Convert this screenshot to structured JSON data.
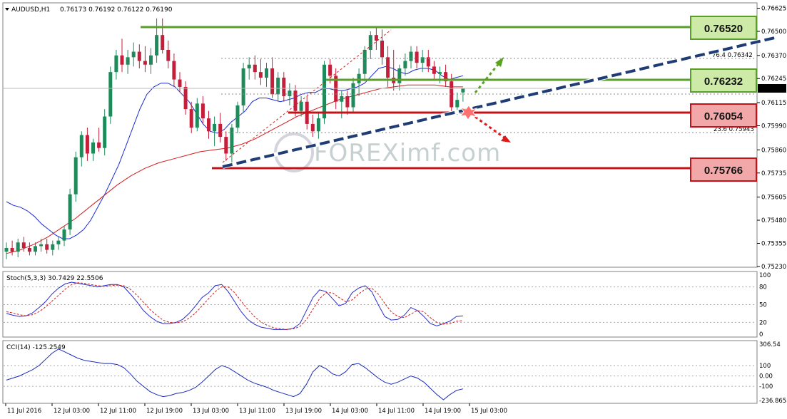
{
  "header": {
    "symbol_tf": "AUDUSD,H1",
    "ohlc": "0.76173 0.76192 0.76122 0.76190"
  },
  "watermark": "FOREXimf.com",
  "colors": {
    "bull_candle": "#1f8a5a",
    "bear_candle": "#c41e3a",
    "ma_fast": "#1c2bd6",
    "ma_slow": "#d31c1c",
    "support_line": "#c0141a",
    "resistance_line": "#5a9e2a",
    "trendline": "#1f3d74",
    "green_box": "#cdeaa6",
    "red_box": "#f2a8a8",
    "stoch_main": "#2a2acf",
    "stoch_signal": "#d31c1c",
    "cci": "#1a2ab8"
  },
  "main_panel": {
    "price_axis": [
      "0.76625",
      "0.76500",
      "0.76370",
      "0.76245",
      "0.76115",
      "0.75990",
      "0.75860",
      "0.75735",
      "0.75605",
      "0.75480",
      "0.75355",
      "0.75230"
    ],
    "current_price": "0.76190",
    "levels": [
      {
        "label": "0.76520",
        "kind": "resistance",
        "price": 0.7652
      },
      {
        "label": "0.76232",
        "kind": "resistance",
        "price": 0.76232
      },
      {
        "label": "0.76054",
        "kind": "support",
        "price": 0.76054
      },
      {
        "label": "0.75766",
        "kind": "support",
        "price": 0.75766
      }
    ],
    "fib_labels": [
      "76.4  0.76342",
      "38.0  0.76166",
      "23.6  0.75943"
    ]
  },
  "stoch_panel": {
    "label": "Stoch(5,3,3) 30.7429 22.5506",
    "axis": [
      "100",
      "80",
      "50",
      "20",
      "0"
    ]
  },
  "cci_panel": {
    "label": "CCI(14) -125.2549",
    "axis": [
      "306.54",
      "100",
      "0.00",
      "-100",
      "-236.8658"
    ]
  },
  "time_axis": [
    "11 Jul 2016",
    "12 Jul 03:00",
    "12 Jul 11:00",
    "12 Jul 19:00",
    "13 Jul 03:00",
    "13 Jul 11:00",
    "13 Jul 19:00",
    "14 Jul 03:00",
    "14 Jul 11:00",
    "14 Jul 19:00",
    "15 Jul 03:00"
  ],
  "chart_data": {
    "type": "candlestick",
    "title": "AUDUSD,H1",
    "ylim": [
      0.7523,
      0.7665
    ],
    "candles": [
      [
        0.7531,
        0.7536,
        0.7527,
        0.7533
      ],
      [
        0.7533,
        0.7537,
        0.7529,
        0.7531
      ],
      [
        0.7531,
        0.7538,
        0.7528,
        0.7536
      ],
      [
        0.7536,
        0.7539,
        0.7531,
        0.7533
      ],
      [
        0.7533,
        0.7536,
        0.7529,
        0.7531
      ],
      [
        0.7531,
        0.7536,
        0.7529,
        0.7534
      ],
      [
        0.7534,
        0.7538,
        0.7531,
        0.7535
      ],
      [
        0.7535,
        0.7538,
        0.753,
        0.7532
      ],
      [
        0.7532,
        0.7537,
        0.7529,
        0.7535
      ],
      [
        0.7535,
        0.7539,
        0.7532,
        0.7537
      ],
      [
        0.7537,
        0.7545,
        0.7534,
        0.7543
      ],
      [
        0.7543,
        0.7565,
        0.754,
        0.7562
      ],
      [
        0.7562,
        0.7585,
        0.7558,
        0.7582
      ],
      [
        0.7582,
        0.7596,
        0.7577,
        0.7594
      ],
      [
        0.7594,
        0.7598,
        0.758,
        0.7584
      ],
      [
        0.7584,
        0.7592,
        0.758,
        0.759
      ],
      [
        0.759,
        0.7598,
        0.7585,
        0.7587
      ],
      [
        0.7587,
        0.7608,
        0.7583,
        0.7604
      ],
      [
        0.7604,
        0.7631,
        0.76,
        0.7628
      ],
      [
        0.7628,
        0.764,
        0.7624,
        0.7637
      ],
      [
        0.7637,
        0.7646,
        0.7628,
        0.7632
      ],
      [
        0.7632,
        0.764,
        0.7627,
        0.7636
      ],
      [
        0.7636,
        0.7644,
        0.7631,
        0.7639
      ],
      [
        0.7639,
        0.7643,
        0.763,
        0.7634
      ],
      [
        0.7634,
        0.7642,
        0.7628,
        0.7632
      ],
      [
        0.7632,
        0.7641,
        0.7627,
        0.7637
      ],
      [
        0.7637,
        0.7657,
        0.7633,
        0.7648
      ],
      [
        0.7648,
        0.7657,
        0.7638,
        0.764
      ],
      [
        0.764,
        0.7645,
        0.763,
        0.7634
      ],
      [
        0.7634,
        0.7638,
        0.762,
        0.7624
      ],
      [
        0.7624,
        0.7628,
        0.7617,
        0.762
      ],
      [
        0.762,
        0.7623,
        0.7605,
        0.7608
      ],
      [
        0.7608,
        0.7612,
        0.7595,
        0.7598
      ],
      [
        0.7598,
        0.7614,
        0.7596,
        0.7611
      ],
      [
        0.7611,
        0.7615,
        0.76,
        0.7603
      ],
      [
        0.7603,
        0.7607,
        0.7592,
        0.7596
      ],
      [
        0.7596,
        0.7604,
        0.7588,
        0.76
      ],
      [
        0.76,
        0.7606,
        0.759,
        0.7593
      ],
      [
        0.7593,
        0.7596,
        0.758,
        0.7584
      ],
      [
        0.7584,
        0.76,
        0.7579,
        0.7598
      ],
      [
        0.7598,
        0.7612,
        0.7595,
        0.761
      ],
      [
        0.761,
        0.7633,
        0.7606,
        0.763
      ],
      [
        0.763,
        0.7636,
        0.7624,
        0.7632
      ],
      [
        0.7632,
        0.7637,
        0.7624,
        0.7628
      ],
      [
        0.7628,
        0.7635,
        0.7621,
        0.7625
      ],
      [
        0.7625,
        0.7633,
        0.762,
        0.763
      ],
      [
        0.763,
        0.7636,
        0.7614,
        0.7616
      ],
      [
        0.7616,
        0.7628,
        0.7612,
        0.7625
      ],
      [
        0.7625,
        0.7628,
        0.7612,
        0.7615
      ],
      [
        0.7615,
        0.7622,
        0.761,
        0.7618
      ],
      [
        0.7618,
        0.7621,
        0.7604,
        0.7607
      ],
      [
        0.7607,
        0.7615,
        0.7604,
        0.7612
      ],
      [
        0.7612,
        0.7615,
        0.7597,
        0.76
      ],
      [
        0.76,
        0.7605,
        0.7593,
        0.7596
      ],
      [
        0.7596,
        0.7606,
        0.7592,
        0.7603
      ],
      [
        0.7603,
        0.7634,
        0.76,
        0.7632
      ],
      [
        0.7632,
        0.7635,
        0.7622,
        0.7626
      ],
      [
        0.7626,
        0.763,
        0.7608,
        0.7612
      ],
      [
        0.7612,
        0.7618,
        0.7603,
        0.7615
      ],
      [
        0.7615,
        0.7618,
        0.7605,
        0.7609
      ],
      [
        0.7609,
        0.7625,
        0.7606,
        0.7622
      ],
      [
        0.7622,
        0.763,
        0.7615,
        0.7627
      ],
      [
        0.7627,
        0.7642,
        0.7623,
        0.764
      ],
      [
        0.764,
        0.765,
        0.7635,
        0.7648
      ],
      [
        0.7648,
        0.7652,
        0.764,
        0.7645
      ],
      [
        0.7645,
        0.7651,
        0.7632,
        0.7636
      ],
      [
        0.7636,
        0.7642,
        0.762,
        0.7625
      ],
      [
        0.7625,
        0.764,
        0.7618,
        0.7622
      ],
      [
        0.7622,
        0.7632,
        0.7618,
        0.763
      ],
      [
        0.763,
        0.7638,
        0.7626,
        0.7634
      ],
      [
        0.7634,
        0.7642,
        0.763,
        0.7639
      ],
      [
        0.7639,
        0.7642,
        0.763,
        0.7633
      ],
      [
        0.7633,
        0.764,
        0.7628,
        0.7636
      ],
      [
        0.7636,
        0.764,
        0.7628,
        0.7631
      ],
      [
        0.7631,
        0.7634,
        0.7624,
        0.7627
      ],
      [
        0.7627,
        0.7631,
        0.7622,
        0.7628
      ],
      [
        0.7628,
        0.7632,
        0.762,
        0.7623
      ],
      [
        0.7623,
        0.7627,
        0.7606,
        0.7609
      ],
      [
        0.7609,
        0.7617,
        0.7605,
        0.7613
      ],
      [
        0.7617,
        0.7619,
        0.7612,
        0.7619
      ]
    ],
    "ma_fast_points": [
      0.7558,
      0.7556,
      0.7555,
      0.7553,
      0.755,
      0.7546,
      0.7543,
      0.754,
      0.7538,
      0.7538,
      0.754,
      0.7543,
      0.7548,
      0.7555,
      0.7562,
      0.757,
      0.7578,
      0.7588,
      0.7598,
      0.7608,
      0.7616,
      0.762,
      0.7622,
      0.7622,
      0.762,
      0.7616,
      0.7612,
      0.7606,
      0.76,
      0.7596,
      0.7595,
      0.7597,
      0.7601,
      0.7604,
      0.7607,
      0.7612,
      0.7614,
      0.7614,
      0.7613,
      0.7612,
      0.7613,
      0.7614,
      0.7616,
      0.7617,
      0.7617,
      0.7619,
      0.7619,
      0.7618,
      0.7618,
      0.7619,
      0.762,
      0.7622,
      0.7626,
      0.763,
      0.7631,
      0.763,
      0.7628,
      0.7627,
      0.7629,
      0.763,
      0.763,
      0.7629,
      0.7626,
      0.7624,
      0.7625,
      0.7626
    ],
    "ma_slow_points": [
      0.753,
      0.7532,
      0.7535,
      0.7539,
      0.7544,
      0.7549,
      0.7555,
      0.7561,
      0.7567,
      0.7572,
      0.7576,
      0.7579,
      0.7581,
      0.7583,
      0.7585,
      0.7586,
      0.7587,
      0.7589,
      0.7592,
      0.7596,
      0.76,
      0.7604,
      0.7607,
      0.761,
      0.7613,
      0.7615,
      0.7617,
      0.7619,
      0.762,
      0.7621,
      0.7621,
      0.7621,
      0.762,
      0.762
    ],
    "stoch_main": [
      35,
      32,
      30,
      31,
      36,
      45,
      55,
      68,
      78,
      85,
      88,
      86,
      84,
      82,
      80,
      82,
      84,
      84,
      80,
      68,
      55,
      40,
      30,
      22,
      18,
      18,
      20,
      25,
      35,
      48,
      62,
      70,
      82,
      84,
      72,
      55,
      38,
      25,
      17,
      12,
      10,
      8,
      8,
      8,
      10,
      18,
      40,
      62,
      75,
      72,
      60,
      48,
      52,
      70,
      78,
      82,
      72,
      50,
      30,
      24,
      25,
      32,
      45,
      40,
      30,
      18,
      14,
      18,
      22,
      30,
      31
    ],
    "stoch_signal": [
      38,
      36,
      33,
      31,
      33,
      38,
      46,
      56,
      66,
      76,
      84,
      87,
      86,
      84,
      82,
      81,
      82,
      83,
      82,
      76,
      66,
      54,
      42,
      32,
      24,
      20,
      19,
      21,
      27,
      36,
      48,
      60,
      72,
      80,
      80,
      70,
      56,
      42,
      30,
      21,
      15,
      11,
      9,
      8,
      9,
      13,
      25,
      42,
      60,
      70,
      70,
      62,
      55,
      58,
      68,
      76,
      78,
      68,
      52,
      38,
      30,
      28,
      34,
      40,
      38,
      28,
      20,
      17,
      18,
      22,
      23
    ],
    "cci": [
      -40,
      -20,
      0,
      30,
      60,
      100,
      160,
      220,
      260,
      230,
      200,
      170,
      150,
      140,
      130,
      120,
      120,
      110,
      80,
      20,
      -50,
      -100,
      -150,
      -180,
      -200,
      -190,
      -170,
      -160,
      -140,
      -110,
      -60,
      0,
      60,
      100,
      80,
      40,
      0,
      -40,
      -70,
      -90,
      -110,
      -140,
      -160,
      -180,
      -200,
      -170,
      -80,
      40,
      100,
      70,
      20,
      0,
      40,
      110,
      120,
      80,
      30,
      -20,
      -60,
      -80,
      -60,
      -30,
      0,
      -20,
      -60,
      -120,
      -180,
      -230,
      -180,
      -140,
      -125
    ],
    "xlabel": "",
    "ylabel": ""
  }
}
